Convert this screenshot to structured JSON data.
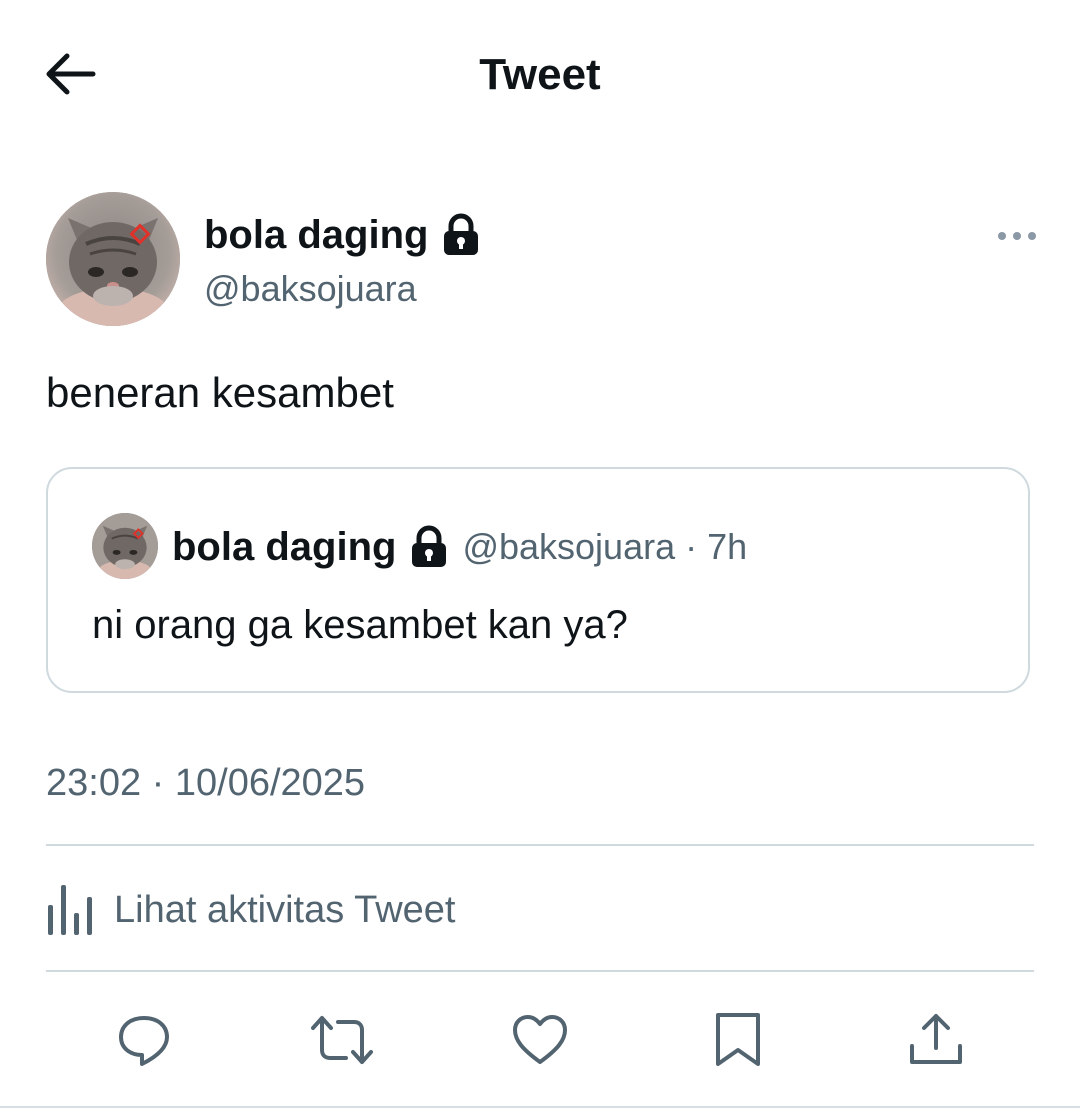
{
  "header": {
    "title": "Tweet",
    "back_icon": "arrow-left-icon"
  },
  "tweet": {
    "author": {
      "display_name": "bola daging",
      "handle": "@baksojuara",
      "protected_icon": "lock-icon",
      "avatar": "kitten-avatar"
    },
    "more_icon": "more-horizontal-icon",
    "text": "beneran kesambet",
    "timestamp": "23:02 · 10/06/2025"
  },
  "quote": {
    "display_name": "bola daging",
    "handle_time": "@baksojuara · 7h",
    "text": "ni orang ga kesambet kan ya?"
  },
  "activity": {
    "label": "Lihat aktivitas Tweet",
    "icon": "analytics-icon"
  },
  "actions": [
    {
      "name": "reply",
      "icon": "reply-icon"
    },
    {
      "name": "retweet",
      "icon": "retweet-icon"
    },
    {
      "name": "like",
      "icon": "heart-icon"
    },
    {
      "name": "bookmark",
      "icon": "bookmark-icon"
    },
    {
      "name": "share",
      "icon": "share-icon"
    }
  ],
  "colors": {
    "text_primary": "#0f1419",
    "text_secondary": "#536471",
    "border": "#cfd9de",
    "background": "#ffffff"
  }
}
